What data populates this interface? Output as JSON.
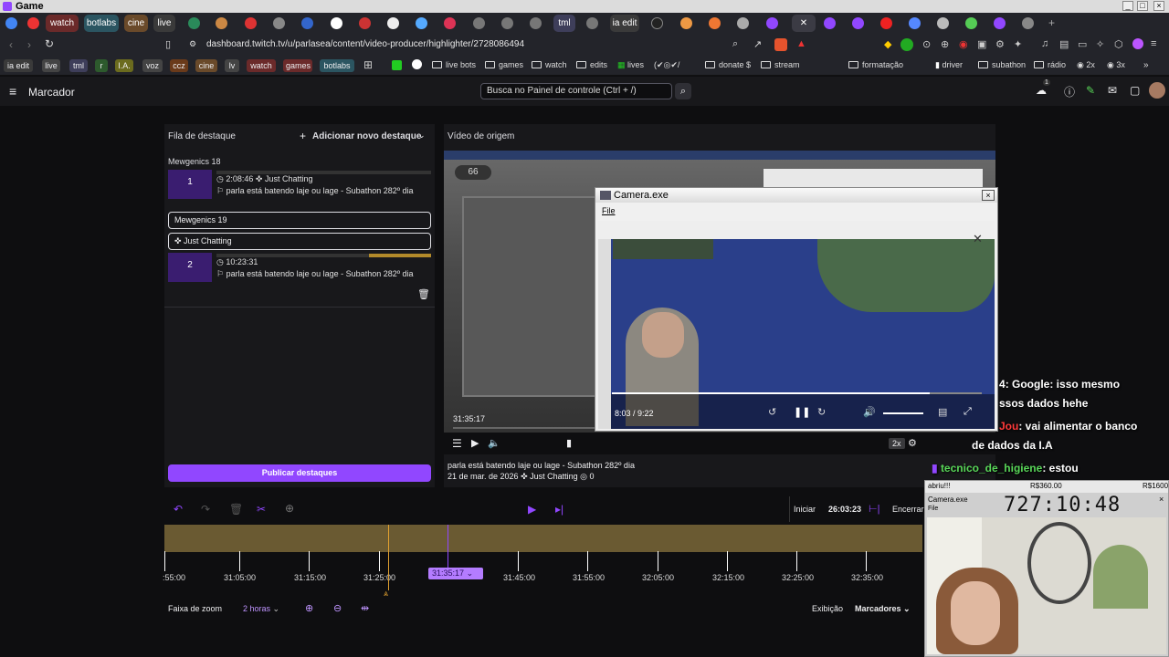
{
  "window": {
    "title": "Game"
  },
  "tabs": [
    {
      "label": "watch",
      "color": "#6b2a2a"
    },
    {
      "label": "botlabs",
      "color": "#2b5561"
    },
    {
      "label": "cine",
      "color": "#6a4a2a"
    },
    {
      "label": "live",
      "color": "#3a3a3a"
    },
    {
      "label": "tml",
      "color": "#3e3e5a"
    },
    {
      "label": "ia edit",
      "color": "#3a3a3a"
    }
  ],
  "address": {
    "url": "dashboard.twitch.tv/u/parlasea/content/video-producer/highlighter/2728086494"
  },
  "bookmark_chips": [
    {
      "label": "ia edit",
      "color": "#3a3a3a",
      "text": "#fff"
    },
    {
      "label": "live",
      "color": "#444",
      "text": "#fff"
    },
    {
      "label": "tml",
      "color": "#3e3e5a",
      "text": "#fff"
    },
    {
      "label": "r",
      "color": "#2d5a2d",
      "text": "#fff"
    },
    {
      "label": "I.A.",
      "color": "#6b6b1e",
      "text": "#fff"
    },
    {
      "label": "voz",
      "color": "#444",
      "text": "#fff"
    },
    {
      "label": "ccz",
      "color": "#6a3a1a",
      "text": "#fff"
    },
    {
      "label": "cine",
      "color": "#6a4a2a",
      "text": "#fff"
    },
    {
      "label": "lv",
      "color": "#444",
      "text": "#fff"
    },
    {
      "label": "watch",
      "color": "#6b2a2a",
      "text": "#fff"
    },
    {
      "label": "games",
      "color": "#6b2a2a",
      "text": "#fff"
    },
    {
      "label": "botlabs",
      "color": "#2b5561",
      "text": "#fff"
    }
  ],
  "bookmarks": [
    "live bots",
    "games",
    "watch",
    "edits",
    "lives",
    "(✔◎✔/",
    "donate $",
    "stream",
    "formatação",
    "driver",
    "subathon",
    "rádio",
    "2x",
    "3x"
  ],
  "header": {
    "menu_label": "Marcador",
    "search_placeholder": "Busca no Painel de controle (Ctrl + /)",
    "notif_count": "1"
  },
  "queue": {
    "title": "Fila de destaque",
    "add_label": "Adicionar novo destaque",
    "group1": "Mewgenics 18",
    "items": [
      {
        "num": "1",
        "time": "2:08:46",
        "category": "Just Chatting",
        "desc": "parla está batendo laje ou lage - Subathon 282º dia"
      },
      {
        "num": "2",
        "time": "10:23:31",
        "category": "",
        "desc": "parla está batendo laje ou lage - Subathon 282º dia"
      }
    ],
    "edit_title": "Mewgenics 19",
    "edit_category": "Just Chatting",
    "publish_label": "Publicar destaques"
  },
  "source": {
    "title": "Vídeo de origem",
    "time": "31:35:17",
    "speed": "2x",
    "desc": "parla está batendo laje ou lage - Subathon 282º dia",
    "date": "21 de mar. de 2026",
    "category": "Just Chatting",
    "views": "0"
  },
  "camera": {
    "title": "Camera.exe",
    "menu": "File",
    "time": "8:03 / 9:22",
    "progress": 0.86
  },
  "chat": [
    {
      "user": "4",
      "text": ": Google: isso mesmo"
    },
    {
      "user": "",
      "text": "ssos dados hehe"
    },
    {
      "user": "Jou",
      "text": ": vai alimentar o banco"
    },
    {
      "user": "",
      "text": "de dados da I.A"
    },
    {
      "user": "tecnico_de_higiene",
      "text": ": estou"
    }
  ],
  "overlay": {
    "top": "abriu!!!",
    "money1": "R$360.00",
    "money2": "R$1600",
    "cam_title": "Camera.exe",
    "menu": "File",
    "clock": "727:10:48"
  },
  "timeline": {
    "start_label": "Iniciar",
    "start_time": "26:03:23",
    "end_label": "Encerrar",
    "ticks": [
      ":55:00",
      "31:05:00",
      "31:15:00",
      "31:25:00",
      "31:45:00",
      "31:55:00",
      "32:05:00",
      "32:15:00",
      "32:25:00",
      "32:35:00"
    ],
    "playhead": "31:35:17",
    "zoom_label": "Faixa de zoom",
    "zoom_value": "2 horas",
    "view_label": "Exibição",
    "markers_label": "Marcadores"
  },
  "colors": {
    "accent": "#9147ff",
    "track": "#6a5a32",
    "highlight_bar": "#b28a2a",
    "chat_user_red": "#ff3b3b",
    "chat_user_green": "#58d658"
  }
}
